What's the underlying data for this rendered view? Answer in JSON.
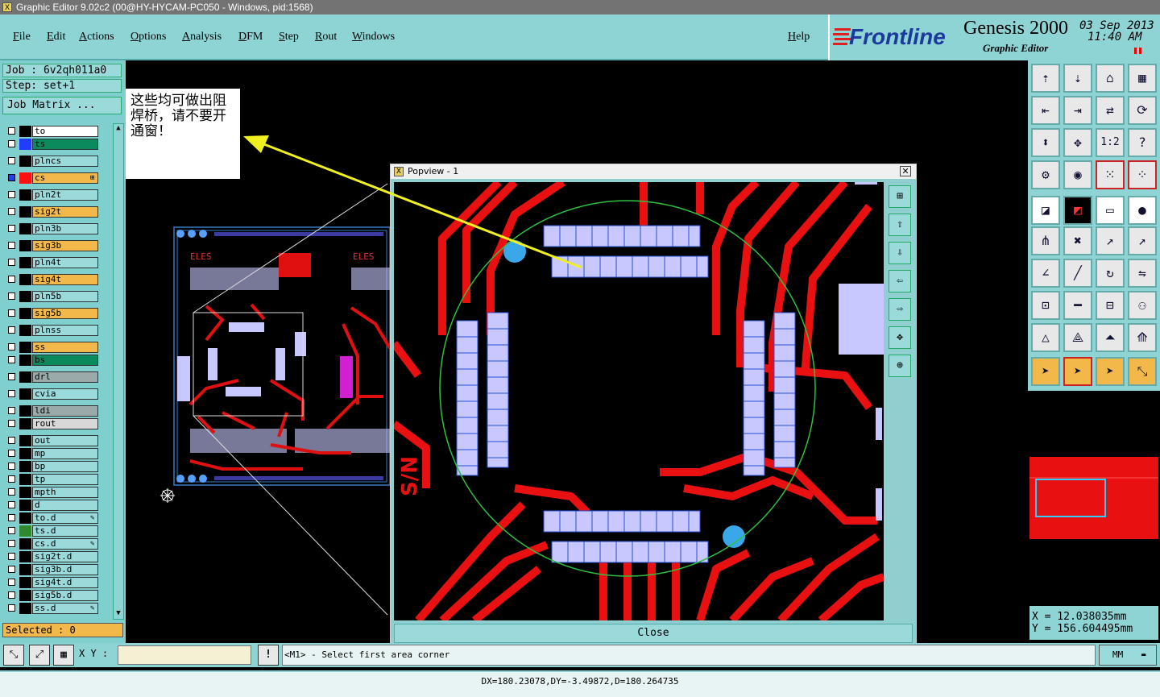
{
  "window": {
    "title": "Graphic Editor 9.02c2 (00@HY-HYCAM-PC050 - Windows, pid:1568)"
  },
  "menu": [
    "File",
    "Edit",
    "Actions",
    "Options",
    "Analysis",
    "DFM",
    "Step",
    "Rout",
    "Windows"
  ],
  "help_label": "Help",
  "logo": {
    "brand": "Frontline",
    "product": "Genesis 2000",
    "subtitle": "Graphic Editor",
    "date": "03 Sep 2013",
    "time": "11:40 AM"
  },
  "job": {
    "job_label": "Job : 6v2qh011a0",
    "step_label": "Step: set+1",
    "matrix_button": "Job Matrix ..."
  },
  "layers": [
    {
      "name": "to",
      "color": "#ffffff",
      "swatch": "#000000"
    },
    {
      "name": "ts",
      "color": "#0b8a5e",
      "swatch": "#1f3cff"
    },
    {
      "name": "plncs",
      "color": "#9adada",
      "swatch": "#000000"
    },
    {
      "name": "cs",
      "color": "#f2b84a",
      "swatch": "#ff1010",
      "marker": "⊞"
    },
    {
      "name": "pln2t",
      "color": "#9adada",
      "swatch": "#000000"
    },
    {
      "name": "sig2t",
      "color": "#f2b84a",
      "swatch": "#000000"
    },
    {
      "name": "pln3b",
      "color": "#9adada",
      "swatch": "#000000"
    },
    {
      "name": "sig3b",
      "color": "#f2b84a",
      "swatch": "#000000"
    },
    {
      "name": "pln4t",
      "color": "#9adada",
      "swatch": "#000000"
    },
    {
      "name": "sig4t",
      "color": "#f2b84a",
      "swatch": "#000000"
    },
    {
      "name": "pln5b",
      "color": "#9adada",
      "swatch": "#000000"
    },
    {
      "name": "sig5b",
      "color": "#f2b84a",
      "swatch": "#000000"
    },
    {
      "name": "plnss",
      "color": "#9adada",
      "swatch": "#000000"
    },
    {
      "name": "ss",
      "color": "#f2b84a",
      "swatch": "#000000"
    },
    {
      "name": "bs",
      "color": "#0b8a5e",
      "swatch": "#000000"
    },
    {
      "name": "drl",
      "color": "#9aaaaa",
      "swatch": "#000000"
    },
    {
      "name": "cvia",
      "color": "#9adada",
      "swatch": "#000000"
    },
    {
      "name": "ldi",
      "color": "#9aaaaa",
      "swatch": "#000000"
    },
    {
      "name": "rout",
      "color": "#d8d8d8",
      "swatch": "#000000"
    },
    {
      "name": "out",
      "color": "#9adada",
      "swatch": "#000000"
    },
    {
      "name": "mp",
      "color": "#9adada",
      "swatch": "#000000"
    },
    {
      "name": "bp",
      "color": "#9adada",
      "swatch": "#000000"
    },
    {
      "name": "tp",
      "color": "#9adada",
      "swatch": "#000000"
    },
    {
      "name": "mpth",
      "color": "#9adada",
      "swatch": "#000000"
    },
    {
      "name": "d",
      "color": "#9adada",
      "swatch": "#000000"
    },
    {
      "name": "to.d",
      "color": "#9adada",
      "swatch": "#000000",
      "marker": "✎"
    },
    {
      "name": "ts.d",
      "color": "#9adada",
      "swatch": "#2f8a2f"
    },
    {
      "name": "cs.d",
      "color": "#9adada",
      "swatch": "#000000",
      "marker": "✎"
    },
    {
      "name": "sig2t.d",
      "color": "#9adada",
      "swatch": "#000000"
    },
    {
      "name": "sig3b.d",
      "color": "#9adada",
      "swatch": "#000000"
    },
    {
      "name": "sig4t.d",
      "color": "#9adada",
      "swatch": "#000000"
    },
    {
      "name": "sig5b.d",
      "color": "#9adada",
      "swatch": "#000000"
    },
    {
      "name": "ss.d",
      "color": "#9adada",
      "swatch": "#000000",
      "marker": "✎"
    }
  ],
  "selected_label": "Selected : 0",
  "annotation": {
    "text": "这些均可做出阻焊桥，请不要开通窗！"
  },
  "popview": {
    "title": "Popview - 1",
    "close_label": "Close",
    "silk_text": "S/N"
  },
  "board": {
    "label_left": "ELES",
    "label_right": "ELES"
  },
  "coords": {
    "x": "X = 12.038035mm",
    "y": "Y = 156.604495mm"
  },
  "bottom": {
    "xy_label": "X Y :",
    "message": "<M1> - Select first area corner",
    "units": "MM"
  },
  "status": {
    "text": "DX=180.23078,DY=-3.49872,D=180.264735"
  }
}
